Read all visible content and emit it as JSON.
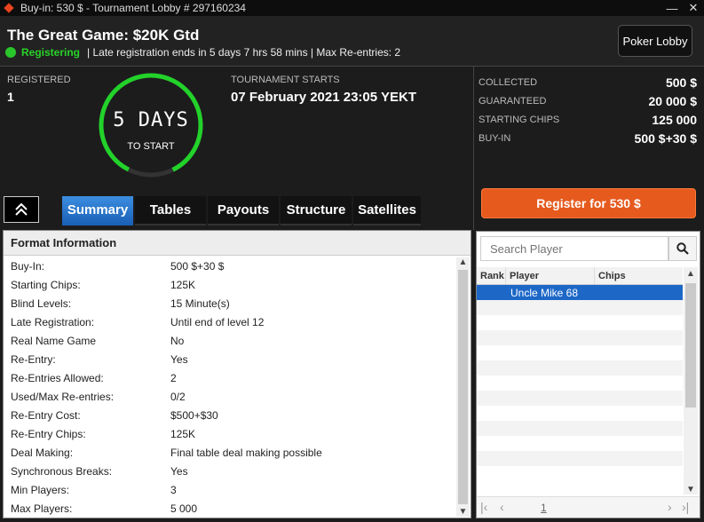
{
  "window": {
    "title": "Buy-in: 530 $ - Tournament Lobby # 297160234",
    "minimize": "—",
    "close": "✕"
  },
  "header": {
    "name": "The Great Game: $20K Gtd",
    "status": "Registering",
    "late_reg": "| Late registration ends in 5 days 7 hrs  58 mins  | Max Re-entries: 2",
    "lobby_button": "Poker Lobby"
  },
  "registered": {
    "label": "REGISTERED",
    "value": "1"
  },
  "countdown": {
    "value": "5 DAYS",
    "caption": "TO START"
  },
  "starts": {
    "label": "TOURNAMENT STARTS",
    "value": "07 February 2021  23:05 YEKT"
  },
  "stats": [
    {
      "label": "COLLECTED",
      "value": "500 $"
    },
    {
      "label": "GUARANTEED",
      "value": "20 000 $"
    },
    {
      "label": "STARTING CHIPS",
      "value": "125 000"
    },
    {
      "label": "BUY-IN",
      "value": "500 $+30 $"
    }
  ],
  "register_button": "Register for  530 $",
  "tabs": [
    {
      "label": "Summary",
      "active": true
    },
    {
      "label": "Tables"
    },
    {
      "label": "Payouts"
    },
    {
      "label": "Structure"
    },
    {
      "label": "Satellites"
    }
  ],
  "format": {
    "title": "Format Information",
    "rows": [
      {
        "k": "Buy-In:",
        "v": "500 $+30 $"
      },
      {
        "k": "Starting Chips:",
        "v": "125K"
      },
      {
        "k": "Blind Levels:",
        "v": "15 Minute(s)"
      },
      {
        "k": "Late Registration:",
        "v": "Until end of level 12"
      },
      {
        "k": "Real Name Game",
        "v": "No"
      },
      {
        "k": "Re-Entry:",
        "v": "Yes"
      },
      {
        "k": "Re-Entries Allowed:",
        "v": "2"
      },
      {
        "k": "Used/Max Re-entries:",
        "v": "0/2"
      },
      {
        "k": "Re-Entry Cost:",
        "v": "$500+$30"
      },
      {
        "k": "Re-Entry Chips:",
        "v": "125K"
      },
      {
        "k": "Deal Making:",
        "v": "Final table deal making possible"
      },
      {
        "k": "Synchronous Breaks:",
        "v": "Yes"
      },
      {
        "k": "Min Players:",
        "v": "3"
      },
      {
        "k": "Max Players:",
        "v": "5 000"
      }
    ]
  },
  "players": {
    "search_placeholder": "Search Player",
    "columns": [
      "Rank",
      "Player",
      "Chips"
    ],
    "rows": [
      {
        "rank": "",
        "player": "Uncle Mike 68",
        "chips": ""
      }
    ],
    "page": "1"
  }
}
